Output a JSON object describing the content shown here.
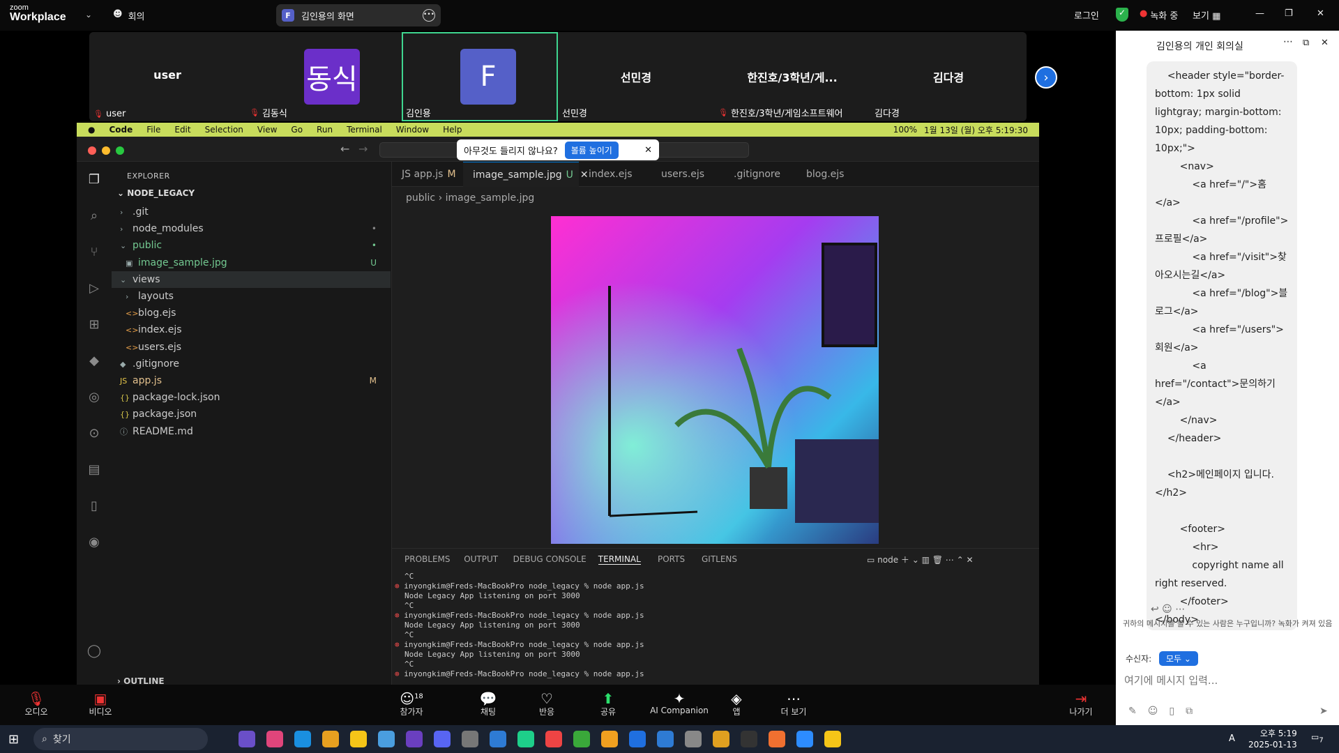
{
  "zoom": {
    "logo_top": "zoom",
    "logo_bottom": "Workplace",
    "meeting_menu": "회의",
    "share_title": "김인용의 화면",
    "share_badge": "F",
    "login": "로그인",
    "recording": "녹화 중",
    "view": "보기"
  },
  "participants": [
    {
      "name": "user",
      "label": "user",
      "muted": true
    },
    {
      "name": "동식",
      "label": "김동식",
      "muted": true,
      "avatar": "동식",
      "color": "#6b2fc9"
    },
    {
      "name": "F",
      "label": "김인용",
      "muted": false,
      "avatar": "F",
      "color": "#5560c8",
      "active": true
    },
    {
      "name": "선민경",
      "label": "선민경",
      "muted": false
    },
    {
      "name": "한진호/3학년/게...",
      "label": "한진호/3학년/게임소프트웨어",
      "muted": true
    },
    {
      "name": "김다경",
      "label": "김다경",
      "muted": false
    }
  ],
  "mac_menu": [
    "Code",
    "File",
    "Edit",
    "Selection",
    "View",
    "Go",
    "Run",
    "Terminal",
    "Window",
    "Help"
  ],
  "mac_status": "1월 13일 (월) 오후 5:19:30",
  "battery": "100%",
  "notice": {
    "text": "아무것도 들리지 않나요?",
    "button": "볼륨 높이기"
  },
  "explorer": {
    "title": "EXPLORER",
    "project": "NODE_LEGACY",
    "items": [
      {
        "label": ".git",
        "indent": 1,
        "type": "folder"
      },
      {
        "label": "node_modules",
        "indent": 1,
        "type": "folder",
        "badge": "•"
      },
      {
        "label": "public",
        "indent": 1,
        "type": "folder-open",
        "badge": "•",
        "color": "#73c991"
      },
      {
        "label": "image_sample.jpg",
        "indent": 2,
        "type": "image",
        "badge": "U",
        "color": "#73c991"
      },
      {
        "label": "views",
        "indent": 1,
        "type": "folder-open"
      },
      {
        "label": "layouts",
        "indent": 2,
        "type": "folder"
      },
      {
        "label": "blog.ejs",
        "indent": 2,
        "type": "ejs"
      },
      {
        "label": "index.ejs",
        "indent": 2,
        "type": "ejs"
      },
      {
        "label": "users.ejs",
        "indent": 2,
        "type": "ejs"
      },
      {
        "label": ".gitignore",
        "indent": 1,
        "type": "git"
      },
      {
        "label": "app.js",
        "indent": 1,
        "type": "js",
        "badge": "M",
        "color": "#e2c08d"
      },
      {
        "label": "package-lock.json",
        "indent": 1,
        "type": "json"
      },
      {
        "label": "package.json",
        "indent": 1,
        "type": "json"
      },
      {
        "label": "README.md",
        "indent": 1,
        "type": "info"
      }
    ],
    "outline": "OUTLINE"
  },
  "tabs": [
    {
      "label": "JS app.js",
      "suffix": "M"
    },
    {
      "label": "image_sample.jpg",
      "suffix": "U",
      "current": true
    },
    {
      "label": "index.ejs"
    },
    {
      "label": "users.ejs"
    },
    {
      "label": ".gitignore"
    },
    {
      "label": "blog.ejs"
    }
  ],
  "breadcrumb": [
    "public",
    "image_sample.jpg"
  ],
  "panel_tabs": [
    "PROBLEMS",
    "OUTPUT",
    "DEBUG CONSOLE",
    "TERMINAL",
    "PORTS",
    "GITLENS"
  ],
  "panel_active": "TERMINAL",
  "terminal_shell": "node",
  "terminal_lines": [
    "^C",
    "inyongkim@Freds-MacBookPro node_legacy % node app.js",
    "Node Legacy App listening on port 3000",
    "^C",
    "inyongkim@Freds-MacBookPro node_legacy % node app.js",
    "Node Legacy App listening on port 3000",
    "^C",
    "inyongkim@Freds-MacBookPro node_legacy % node app.js",
    "Node Legacy App listening on port 3000",
    "^C",
    "inyongkim@Freds-MacBookPro node_legacy % node app.js"
  ],
  "chat": {
    "title": "김인용의 개인 회의실",
    "message": "    <header style=\"border-bottom: 1px solid lightgray; margin-bottom: 10px; padding-bottom: 10px;\">\n        <nav>\n            <a href=\"/\">홈</a>\n            <a href=\"/profile\">프로필</a>\n            <a href=\"/visit\">찾아오시는길</a>\n            <a href=\"/blog\">블로그</a>\n            <a href=\"/users\">회원</a>\n            <a href=\"/contact\">문의하기</a>\n        </nav>\n    </header>\n\n    <h2>메인페이지 입니다.</h2>\n\n        <footer>\n            <hr>\n            copyright name all right reserved.\n        </footer>\n</body>\n</html>",
    "visibility_note": "귀하의 메시지를 볼 수 있는 사람은 누구입니까? 녹화가 켜져 있음",
    "recipient_label": "수신자:",
    "recipient": "모두",
    "input_placeholder": "여기에 메시지 입력..."
  },
  "toolbar": {
    "audio": "오디오",
    "video": "비디오",
    "participants": "참가자",
    "participants_count": "18",
    "chat": "채팅",
    "react": "반응",
    "share": "공유",
    "ai": "AI Companion",
    "apps": "앱",
    "more": "더 보기",
    "leave": "나가기"
  },
  "taskbar": {
    "search": "찾기",
    "time": "오후 5:19",
    "date": "2025-01-13",
    "lang": "A",
    "notif": "7"
  }
}
